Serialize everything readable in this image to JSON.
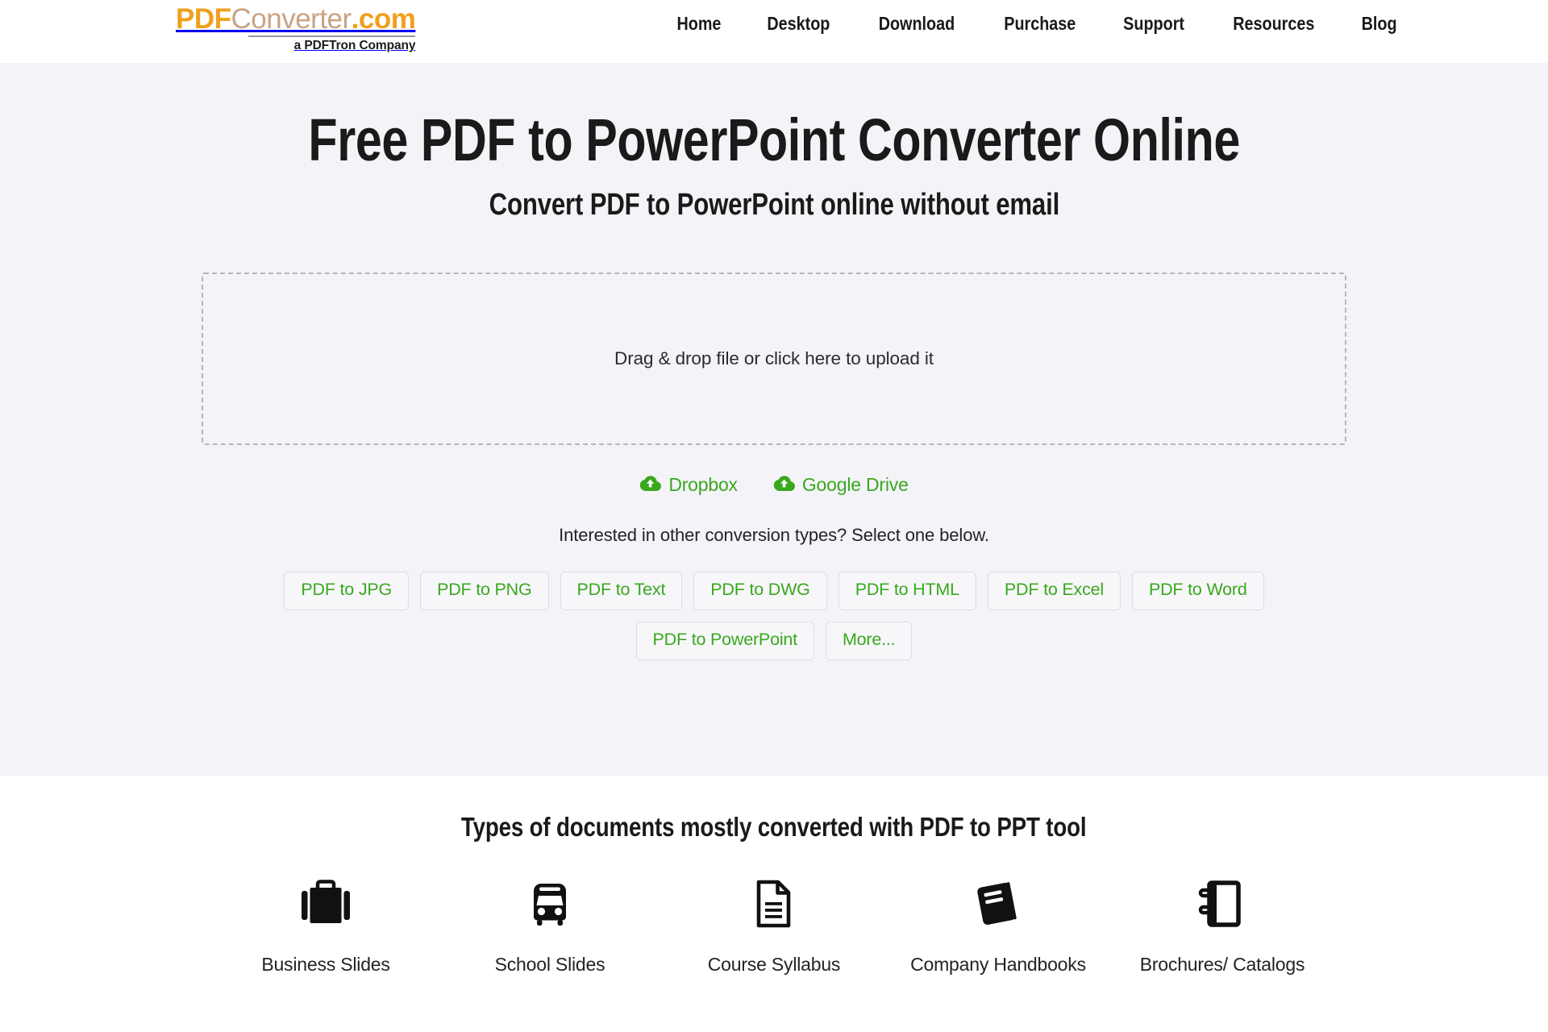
{
  "header": {
    "logo": {
      "pdf": "PDF",
      "converter": "Converter",
      "dotcom": ".com",
      "tagline": "a PDFTron Company"
    },
    "nav": [
      {
        "label": "Home",
        "name": "nav-home"
      },
      {
        "label": "Desktop",
        "name": "nav-desktop"
      },
      {
        "label": "Download",
        "name": "nav-download"
      },
      {
        "label": "Purchase",
        "name": "nav-purchase"
      },
      {
        "label": "Support",
        "name": "nav-support"
      },
      {
        "label": "Resources",
        "name": "nav-resources"
      },
      {
        "label": "Blog",
        "name": "nav-blog"
      }
    ]
  },
  "hero": {
    "title": "Free PDF to PowerPoint Converter Online",
    "subtitle": "Convert PDF to PowerPoint online without email",
    "dropzone_text": "Drag & drop file or click here to upload it",
    "cloud": [
      {
        "label": "Dropbox",
        "icon": "cloud-upload-icon"
      },
      {
        "label": "Google Drive",
        "icon": "cloud-upload-icon"
      }
    ],
    "other_types_prompt": "Interested in other conversion types? Select one below.",
    "conversion_chips_row1": [
      "PDF to JPG",
      "PDF to PNG",
      "PDF to Text",
      "PDF to DWG",
      "PDF to HTML",
      "PDF to Excel",
      "PDF to Word"
    ],
    "conversion_chips_row2": [
      "PDF to PowerPoint",
      "More..."
    ]
  },
  "doctypes": {
    "heading": "Types of documents mostly converted with PDF to PPT tool",
    "items": [
      {
        "label": "Business Slides",
        "icon": "briefcase-icon"
      },
      {
        "label": "School Slides",
        "icon": "bus-icon"
      },
      {
        "label": "Course Syllabus",
        "icon": "document-icon"
      },
      {
        "label": "Company Handbooks",
        "icon": "book-icon"
      },
      {
        "label": "Brochures/ Catalogs",
        "icon": "spiral-notebook-icon"
      }
    ]
  },
  "colors": {
    "brand_orange": "#f0a01e",
    "brand_tan": "#c9a383",
    "green": "#3aa81e",
    "hero_bg": "#f4f4f8",
    "text_dark": "#1a1a1a",
    "chip_border": "#dcdce2",
    "dropzone_border": "#b4b4bc"
  }
}
